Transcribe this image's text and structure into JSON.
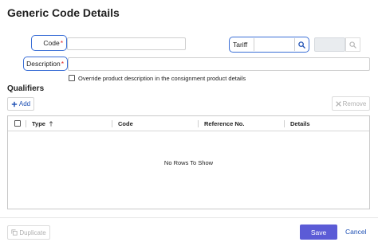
{
  "dialog": {
    "title": "Generic Code Details"
  },
  "form": {
    "code_label": "Code",
    "required_mark": "*",
    "description_label": "Description",
    "tariff_label": "Tariff",
    "override_label": "Override product description in the consignment product details"
  },
  "qualifiers": {
    "title": "Qualifiers",
    "add_label": "Add",
    "remove_label": "Remove",
    "columns": {
      "type": "Type",
      "code": "Code",
      "reference": "Reference No.",
      "details": "Details"
    },
    "empty_text": "No Rows To Show"
  },
  "footer": {
    "duplicate_label": "Duplicate",
    "save_label": "Save",
    "cancel_label": "Cancel"
  },
  "colors": {
    "accent_border": "#3b6fd6",
    "primary_button": "#5b5bd6",
    "link": "#1e50b4",
    "required": "#dd2222"
  },
  "icons": {
    "sort": "arrow-up-icon",
    "search": "search-icon",
    "add": "plus-icon",
    "remove": "close-icon",
    "duplicate": "copy-icon"
  }
}
